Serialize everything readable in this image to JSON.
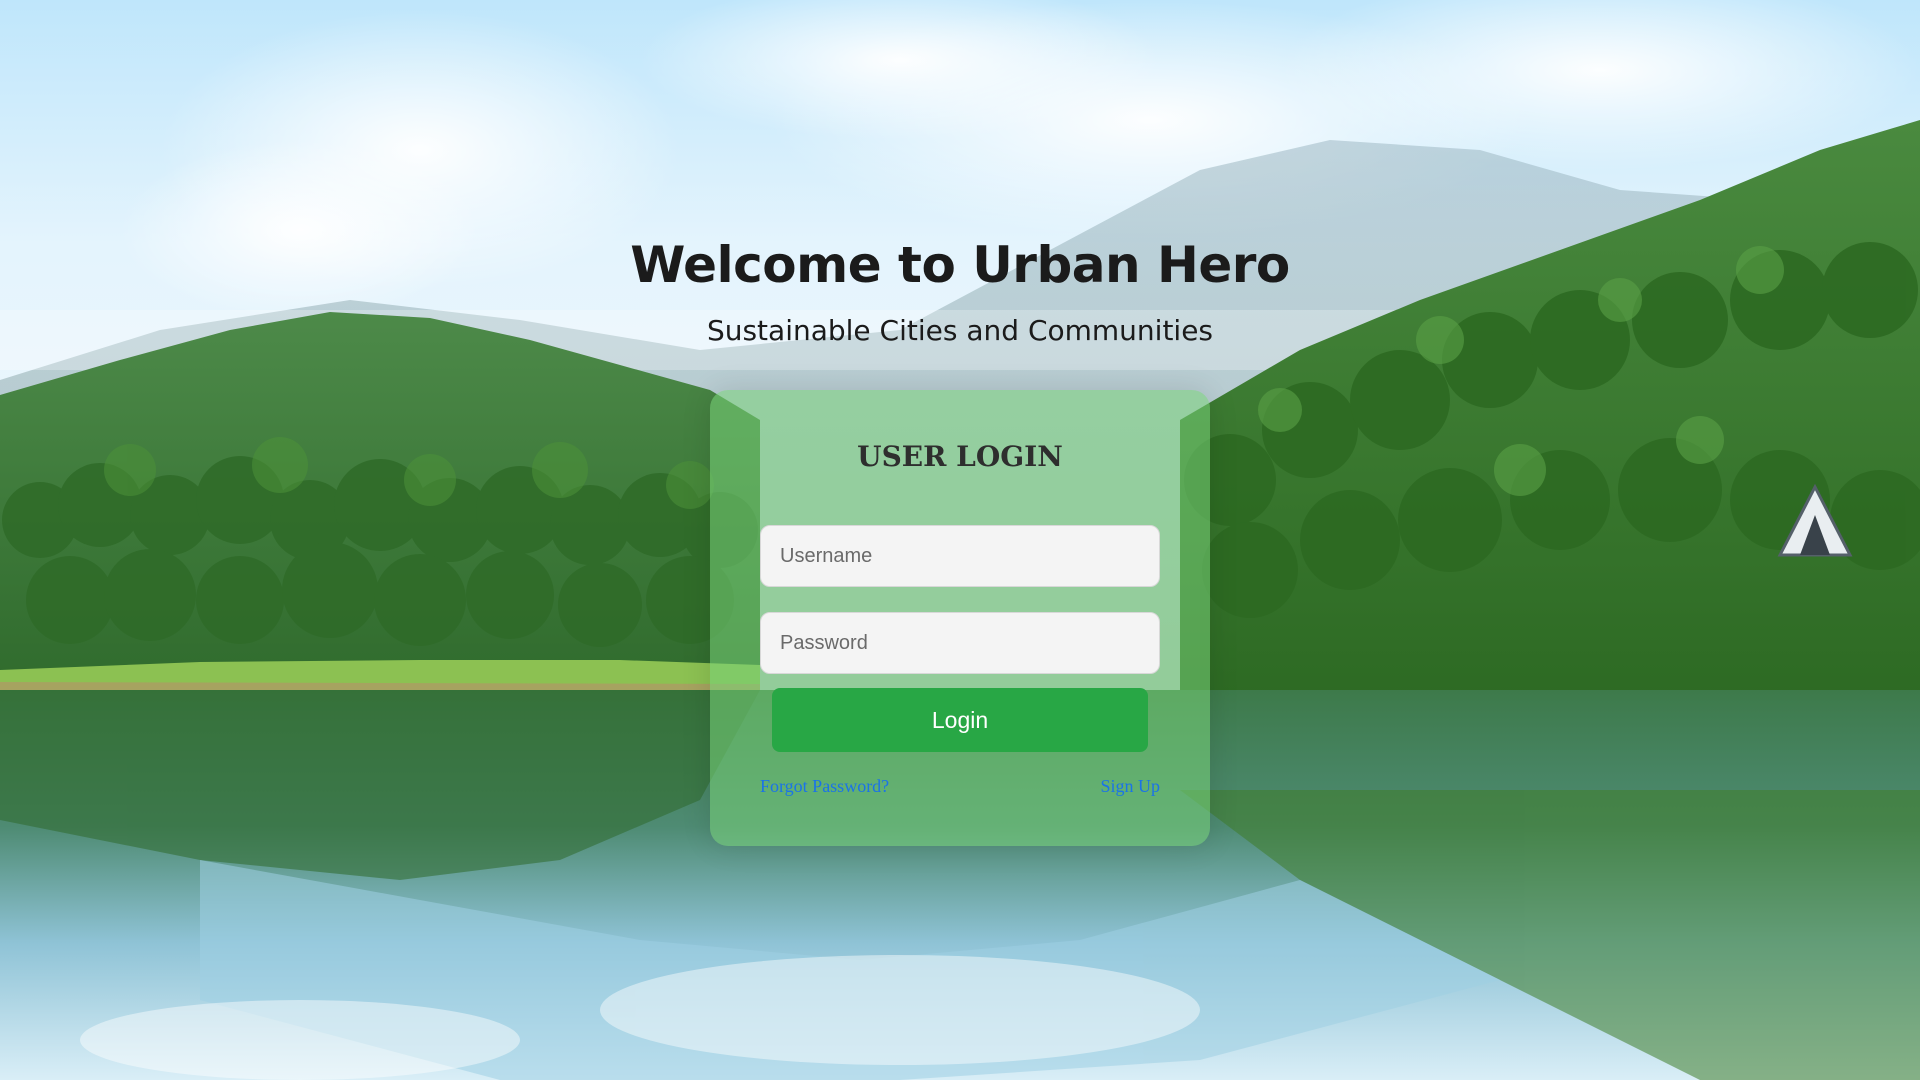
{
  "hero": {
    "title": "Welcome to Urban Hero",
    "subtitle": "Sustainable Cities and Communities"
  },
  "login": {
    "heading": "USER LOGIN",
    "username_placeholder": "Username",
    "password_placeholder": "Password",
    "submit_label": "Login",
    "forgot_label": "Forgot Password?",
    "signup_label": "Sign Up"
  },
  "colors": {
    "primary_button": "#28a745",
    "link": "#1a73e8",
    "card_tint": "rgba(120, 210, 120, 0.55)"
  }
}
